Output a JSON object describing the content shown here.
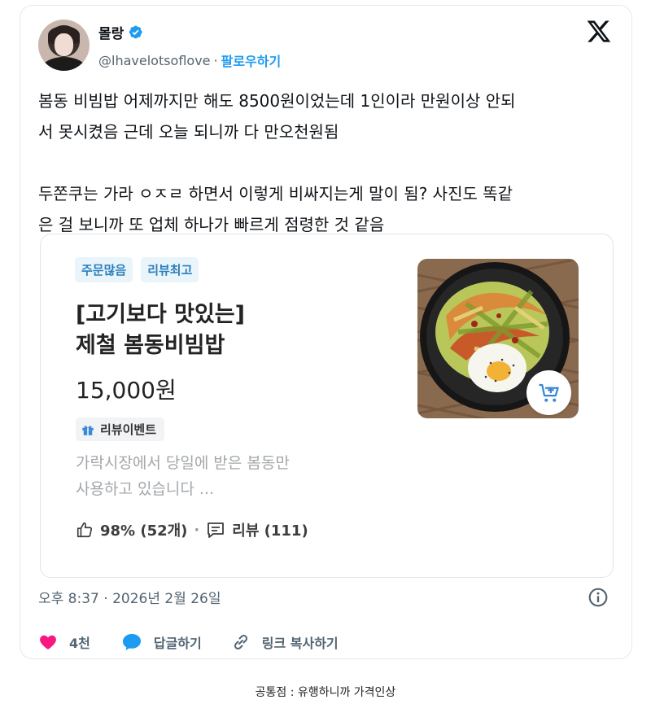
{
  "tweet": {
    "author_name": "몰랑",
    "handle": "@lhavelotsoflove",
    "separator": "·",
    "follow_label": "팔로우하기",
    "text": "봄동 비빔밥 어제까지만 해도 8500원이었는데 1인이라 만원이상 안되\n서 못시켰음 근데 오늘 되니까 다 만오천원됨\n\n두쫀쿠는 가라 ㅇㅈㄹ 하면서 이렇게 비싸지는게 말이 됨? 사진도 똑같\n은 걸 보니까 또 업체 하나가 빠르게 점령한 것 같음",
    "timestamp": "오후 8:37 · 2026년 2월 26일",
    "likes_count": "4천",
    "reply_label": "답글하기",
    "copy_link_label": "링크 복사하기"
  },
  "embed": {
    "tags": [
      "주문많음",
      "리뷰최고"
    ],
    "title": "[고기보다 맛있는]\n제철 봄동비빔밥",
    "price": "15,000원",
    "event_badge": "리뷰이벤트",
    "description": "가락시장에서 당일에 받은 봄동만\n사용하고 있습니다 ...",
    "rating": "98% (52개)",
    "dot": "·",
    "review_label": "리뷰 (111)"
  },
  "caption": "공통점 : 유행하니까 가격인상",
  "colors": {
    "accent": "#1d9bf0",
    "like": "#f91880",
    "tag_text": "#2b7fbb",
    "tag_bg": "#e9f4fb"
  },
  "icons": [
    "verified-badge-icon",
    "x-logo-icon",
    "gift-icon",
    "thumbs-up-icon",
    "review-bubble-icon",
    "cart-add-icon",
    "info-icon",
    "heart-icon",
    "reply-icon",
    "link-icon"
  ]
}
